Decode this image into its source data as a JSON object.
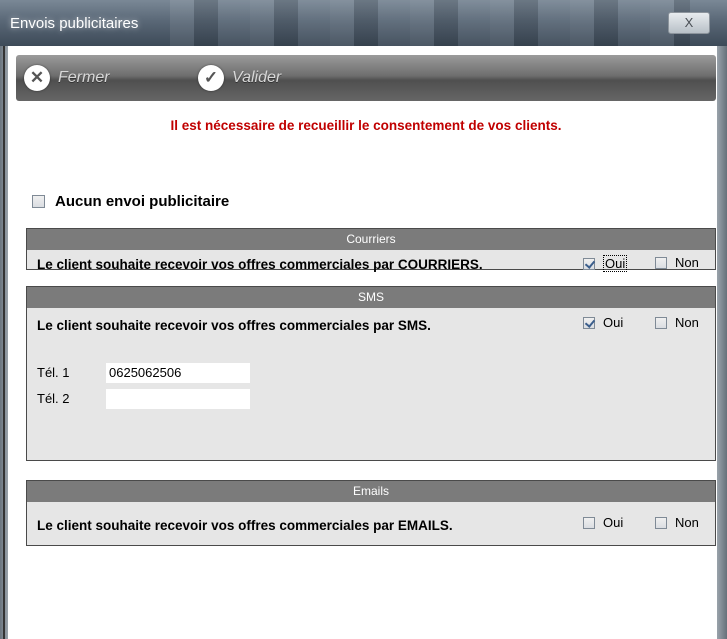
{
  "window": {
    "title": "Envois publicitaires",
    "close_glyph": "X"
  },
  "toolbar": {
    "close_label": "Fermer",
    "close_icon": "x-circle-icon",
    "validate_label": "Valider",
    "validate_icon": "check-circle-icon"
  },
  "warning_text": "Il est nécessaire de recueillir le consentement de vos clients.",
  "no_ads": {
    "label": "Aucun envoi publicitaire",
    "checked": false
  },
  "sections": {
    "courriers": {
      "title": "Courriers",
      "text": "Le client souhaite recevoir vos offres commerciales par COURRIERS.",
      "oui_label": "Oui",
      "oui_checked": true,
      "non_label": "Non",
      "non_checked": false
    },
    "sms": {
      "title": "SMS",
      "text": "Le client souhaite recevoir vos offres commerciales par SMS.",
      "oui_label": "Oui",
      "oui_checked": true,
      "non_label": "Non",
      "non_checked": false,
      "tel1_label": "Tél. 1",
      "tel1_value": "0625062506",
      "tel2_label": "Tél. 2",
      "tel2_value": ""
    },
    "emails": {
      "title": "Emails",
      "text": "Le client souhaite recevoir vos offres commerciales par EMAILS.",
      "oui_label": "Oui",
      "oui_checked": false,
      "non_label": "Non",
      "non_checked": false
    }
  },
  "colors": {
    "warning": "#c00000",
    "section_header": "#7b7b7b",
    "section_body": "#e6e6e6"
  }
}
